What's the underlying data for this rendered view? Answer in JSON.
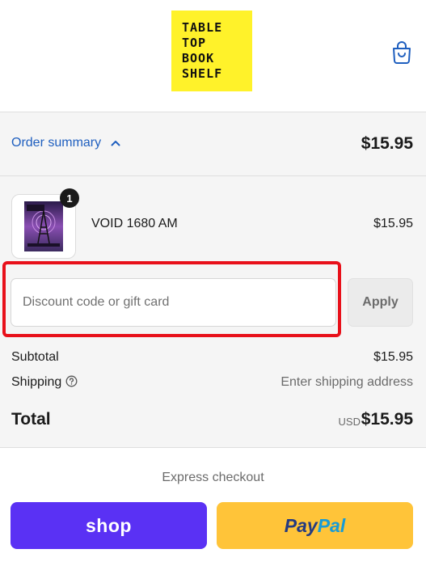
{
  "header": {
    "logo_lines": [
      "TABLE",
      "TOP",
      "BOOK",
      "SHELF"
    ],
    "cart_icon": "shopping-bag-icon",
    "logo_bg": "#fff22a"
  },
  "summary": {
    "toggle_label": "Order summary",
    "toggle_icon": "chevron-up-icon",
    "total": "$15.95"
  },
  "item": {
    "quantity": "1",
    "name": "VOID 1680 AM",
    "price": "$15.95"
  },
  "discount": {
    "placeholder": "Discount code or gift card",
    "apply_label": "Apply"
  },
  "totals": {
    "subtotal_label": "Subtotal",
    "subtotal_value": "$15.95",
    "shipping_label": "Shipping",
    "shipping_value": "Enter shipping address",
    "total_label": "Total",
    "currency": "USD",
    "total_value": "$15.95"
  },
  "express": {
    "label": "Express checkout",
    "shop_label": "shop",
    "paypal_part1": "Pay",
    "paypal_part2": "Pal"
  },
  "colors": {
    "link": "#1f5fbf",
    "shop": "#5a31f4",
    "paypal": "#ffc439",
    "highlight": "#e8101a"
  }
}
